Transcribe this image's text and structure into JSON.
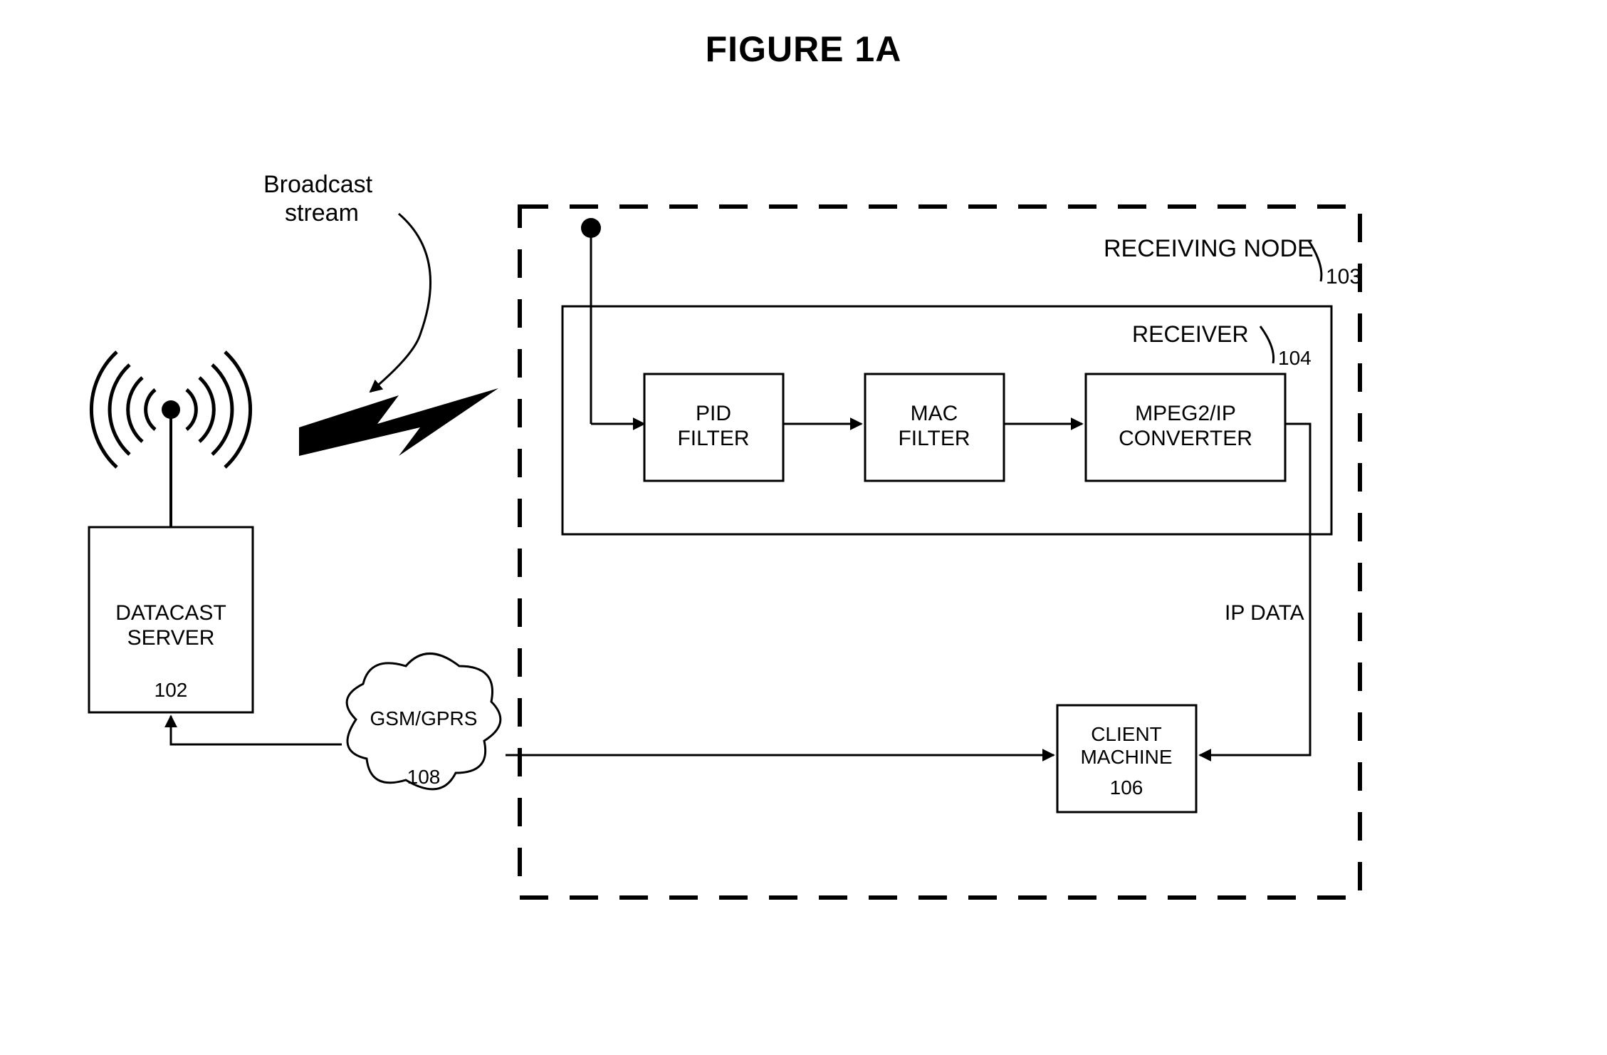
{
  "title": "FIGURE 1A",
  "broadcast_label_l1": "Broadcast",
  "broadcast_label_l2": "stream",
  "datacast_l1": "DATACAST",
  "datacast_l2": "SERVER",
  "datacast_ref": "102",
  "receiving_node_label": "RECEIVING NODE",
  "receiving_node_ref": "103",
  "receiver_label": "RECEIVER",
  "receiver_ref": "104",
  "pid_l1": "PID",
  "pid_l2": "FILTER",
  "mac_l1": "MAC",
  "mac_l2": "FILTER",
  "mpeg_l1": "MPEG2/IP",
  "mpeg_l2": "CONVERTER",
  "ip_data_label": "IP DATA",
  "client_l1": "CLIENT",
  "client_l2": "MACHINE",
  "client_ref": "106",
  "gsm_label": "GSM/GPRS",
  "gsm_ref": "108"
}
